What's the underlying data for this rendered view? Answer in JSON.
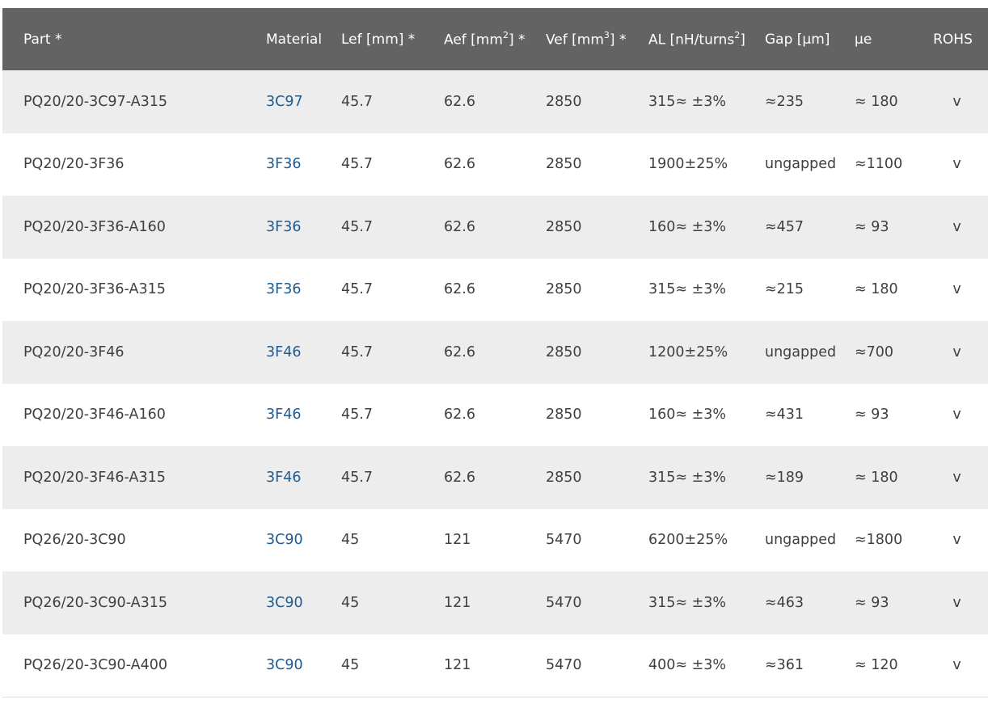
{
  "header": {
    "part": "Part *",
    "material": "Material",
    "lef": "Lef [mm] *",
    "aef_pre": "Aef [mm",
    "aef_sup": "2",
    "aef_post": "] *",
    "vef_pre": "Vef [mm",
    "vef_sup": "3",
    "vef_post": "] *",
    "al_pre": "AL [nH/turns",
    "al_sup": "2",
    "al_post": "]",
    "gap": "Gap [µm]",
    "ue": "µe",
    "rohs": "ROHS"
  },
  "rows": [
    {
      "part": "PQ20/20-3C97-A315",
      "material": "3C97",
      "lef": "45.7",
      "aef": "62.6",
      "vef": "2850",
      "al": "315≈ ±3%",
      "gap": "≈235",
      "ue": "≈ 180",
      "rohs": "v"
    },
    {
      "part": "PQ20/20-3F36",
      "material": "3F36",
      "lef": "45.7",
      "aef": "62.6",
      "vef": "2850",
      "al": "1900±25%",
      "gap": "ungapped",
      "ue": "≈1100",
      "rohs": "v"
    },
    {
      "part": "PQ20/20-3F36-A160",
      "material": "3F36",
      "lef": "45.7",
      "aef": "62.6",
      "vef": "2850",
      "al": "160≈ ±3%",
      "gap": "≈457",
      "ue": "≈ 93",
      "rohs": "v"
    },
    {
      "part": "PQ20/20-3F36-A315",
      "material": "3F36",
      "lef": "45.7",
      "aef": "62.6",
      "vef": "2850",
      "al": "315≈ ±3%",
      "gap": "≈215",
      "ue": "≈ 180",
      "rohs": "v"
    },
    {
      "part": "PQ20/20-3F46",
      "material": "3F46",
      "lef": "45.7",
      "aef": "62.6",
      "vef": "2850",
      "al": "1200±25%",
      "gap": "ungapped",
      "ue": "≈700",
      "rohs": "v"
    },
    {
      "part": "PQ20/20-3F46-A160",
      "material": "3F46",
      "lef": "45.7",
      "aef": "62.6",
      "vef": "2850",
      "al": "160≈ ±3%",
      "gap": "≈431",
      "ue": "≈ 93",
      "rohs": "v"
    },
    {
      "part": "PQ20/20-3F46-A315",
      "material": "3F46",
      "lef": "45.7",
      "aef": "62.6",
      "vef": "2850",
      "al": "315≈ ±3%",
      "gap": "≈189",
      "ue": "≈ 180",
      "rohs": "v"
    },
    {
      "part": "PQ26/20-3C90",
      "material": "3C90",
      "lef": "45",
      "aef": "121",
      "vef": "5470",
      "al": "6200±25%",
      "gap": "ungapped",
      "ue": "≈1800",
      "rohs": "v"
    },
    {
      "part": "PQ26/20-3C90-A315",
      "material": "3C90",
      "lef": "45",
      "aef": "121",
      "vef": "5470",
      "al": "315≈ ±3%",
      "gap": "≈463",
      "ue": "≈ 93",
      "rohs": "v"
    },
    {
      "part": "PQ26/20-3C90-A400",
      "material": "3C90",
      "lef": "45",
      "aef": "121",
      "vef": "5470",
      "al": "400≈ ±3%",
      "gap": "≈361",
      "ue": "≈ 120",
      "rohs": "v"
    }
  ],
  "colors": {
    "header_bg": "#636363",
    "row_odd": "#ededed",
    "row_even": "#ffffff",
    "link": "#1f5a90"
  }
}
